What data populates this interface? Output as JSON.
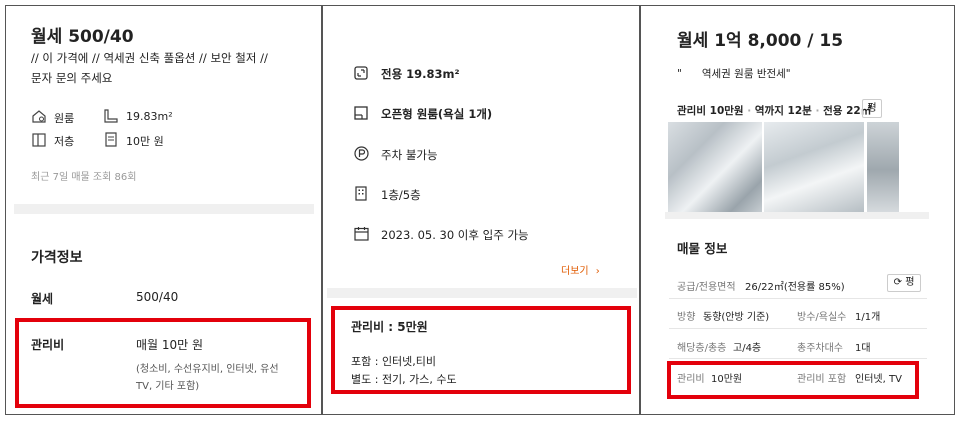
{
  "panel1": {
    "title": "월세 500/40",
    "description_line1": "// 이 가격에 // 역세권 신축 풀옵션 // 보안 철저 //",
    "description_line2": "문자 문의 주세요",
    "specs": {
      "room_type": "원룸",
      "area": "19.83m²",
      "floor": "저층",
      "maintenance": "10만 원"
    },
    "views_text": "최근 7일 매물 조회 86회",
    "price_section_title": "가격정보",
    "rent_label": "월세",
    "rent_value": "500/40",
    "fee_label": "관리비",
    "fee_value": "매월 10만 원",
    "fee_detail_line1": "(청소비, 수선유지비, 인터넷, 유선",
    "fee_detail_line2": "TV, 기타 포함)"
  },
  "panel2": {
    "area": "전용 19.83m²",
    "room": "오픈형 원룸(욕실 1개)",
    "parking": "주차 불가능",
    "floor": "1층/5층",
    "move_in": "2023. 05. 30 이후 입주 가능",
    "more_link": "더보기",
    "fee_title": "관리비 : 5만원",
    "fee_included": "포함 : 인터넷,티비",
    "fee_separate": "별도 : 전기, 가스, 수도"
  },
  "panel3": {
    "title": "월세 1억 8,000 / 15",
    "quote": "\"      역세권 원룸 반전세\"",
    "summary_fee": "관리비 10만원",
    "summary_dot1": "·",
    "summary_station": "역까지 12분",
    "summary_dot2": "·",
    "summary_area": "전용 22㎡",
    "unit_button": "평",
    "section_title": "매물 정보",
    "rows": [
      {
        "label1": "공급/전용면적",
        "value1": "26/22㎡(전용률 85%)",
        "label2": "",
        "value2": ""
      },
      {
        "label1": "방향",
        "value1": "동향(안방 기준)",
        "label2": "방수/욕실수",
        "value2": "1/1개"
      },
      {
        "label1": "해당층/총층",
        "value1": "고/4층",
        "label2": "총주차대수",
        "value2": "1대"
      },
      {
        "label1": "관리비",
        "value1": "10만원",
        "label2": "관리비 포함",
        "value2": "인터넷, TV"
      }
    ],
    "unit_toggle": "평"
  },
  "colors": {
    "highlight": "#e3000b",
    "link": "#e05a00",
    "divider": "#f0f0f0"
  }
}
